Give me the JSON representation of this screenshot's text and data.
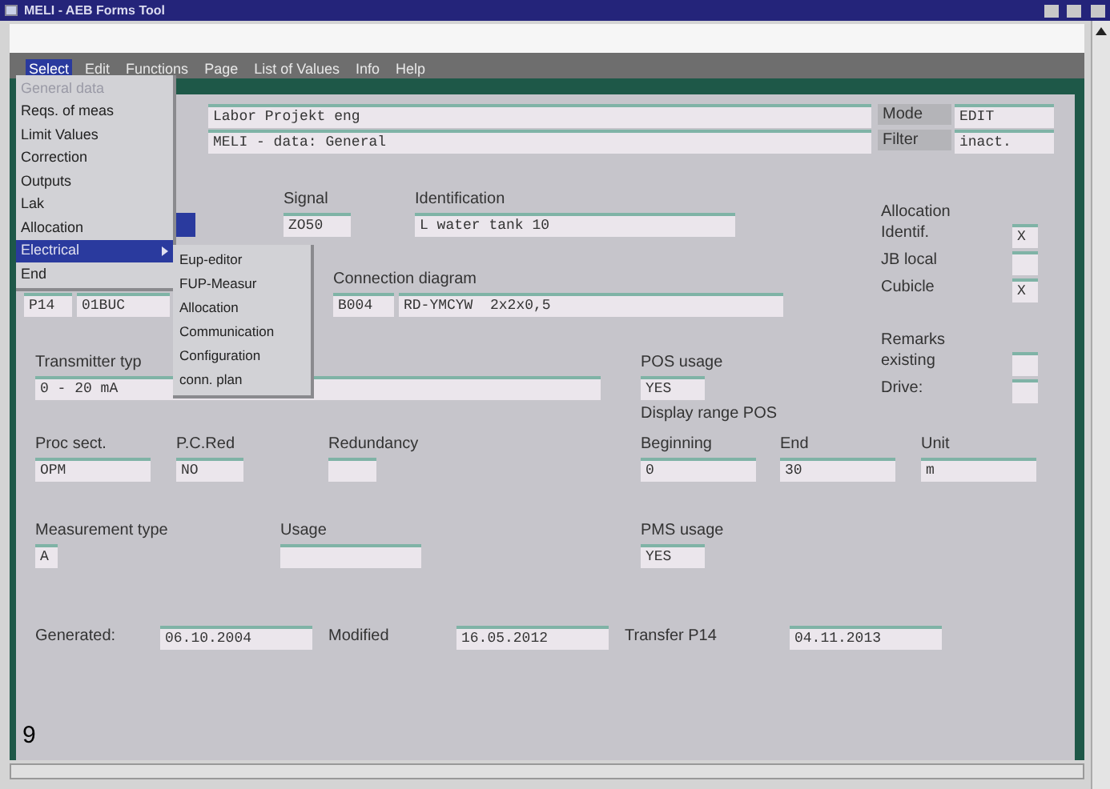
{
  "window": {
    "title": "MELI - AEB Forms Tool"
  },
  "menu_bar": [
    {
      "label": "Select",
      "selected": true
    },
    {
      "label": "Edit",
      "selected": false
    },
    {
      "label": "Functions",
      "selected": false
    },
    {
      "label": "Page",
      "selected": false
    },
    {
      "label": "List of Values",
      "selected": false
    },
    {
      "label": "Info",
      "selected": false
    },
    {
      "label": "Help",
      "selected": false
    }
  ],
  "open_menu": [
    {
      "label": "General data",
      "disabled": true,
      "selected": false,
      "submenu": false
    },
    {
      "label": "Reqs. of meas",
      "disabled": false,
      "selected": false,
      "submenu": false
    },
    {
      "label": "Limit Values",
      "disabled": false,
      "selected": false,
      "submenu": false
    },
    {
      "label": "Correction",
      "disabled": false,
      "selected": false,
      "submenu": false
    },
    {
      "label": "Outputs",
      "disabled": false,
      "selected": false,
      "submenu": false
    },
    {
      "label": "Lak",
      "disabled": false,
      "selected": false,
      "submenu": false
    },
    {
      "label": "Allocation",
      "disabled": false,
      "selected": false,
      "submenu": false
    },
    {
      "label": "Electrical",
      "disabled": false,
      "selected": true,
      "submenu": true
    },
    {
      "label": "End",
      "disabled": false,
      "selected": false,
      "submenu": false
    }
  ],
  "submenu": [
    "Eup-editor",
    "FUP-Measur",
    "Allocation",
    "Communication",
    "Configuration",
    "conn. plan"
  ],
  "header": {
    "line_1": "Labor Projekt eng",
    "line_2": "MELI - data: General",
    "mode_label": "Mode",
    "mode": "EDIT",
    "filter_label": "Filter",
    "filter": "inact."
  },
  "signal": {
    "label": "Signal",
    "value": "ZO50"
  },
  "identification": {
    "label": "Identification",
    "value": "L water tank 10"
  },
  "allocation": {
    "title": "Allocation",
    "fields": [
      {
        "label": "Identif.",
        "value": "X"
      },
      {
        "label": "JB local"
      },
      {
        "label": "Cubicle",
        "value": "X"
      }
    ]
  },
  "plant_code": [
    "P14",
    "01BUC"
  ],
  "connection_diagram": {
    "label": "Connection diagram",
    "values": [
      "B004",
      "RD-YMCYW  2x2x0,5"
    ]
  },
  "remarks": {
    "title": "Remarks",
    "fields": [
      {
        "label": "existing"
      },
      {
        "label": "Drive:"
      }
    ]
  },
  "transmitter_type": {
    "label": "Transmitter typ",
    "value": "0 - 20 mA"
  },
  "pos_usage": {
    "label": "POS usage",
    "value": "YES"
  },
  "display_range_pos": {
    "title": "Display range POS",
    "beginning_label": "Beginning",
    "beginning": "0",
    "end_label": "End",
    "end": "30",
    "unit_label": "Unit",
    "unit": "m"
  },
  "proc_sect": {
    "label": "Proc sect.",
    "value": "OPM"
  },
  "pc_red": {
    "label": "P.C.Red",
    "value": "NO"
  },
  "redundancy": {
    "label": "Redundancy"
  },
  "measurement_type": {
    "label": "Measurement type",
    "value": "A"
  },
  "usage": {
    "label": "Usage"
  },
  "pms_usage": {
    "label": "PMS usage",
    "value": "YES"
  },
  "dates": [
    {
      "label": "Generated:",
      "value": "06.10.2004"
    },
    {
      "label": "Modified",
      "value": "16.05.2012"
    },
    {
      "label": "Transfer P14",
      "value": "04.11.2013"
    }
  ],
  "figure_number": "9"
}
